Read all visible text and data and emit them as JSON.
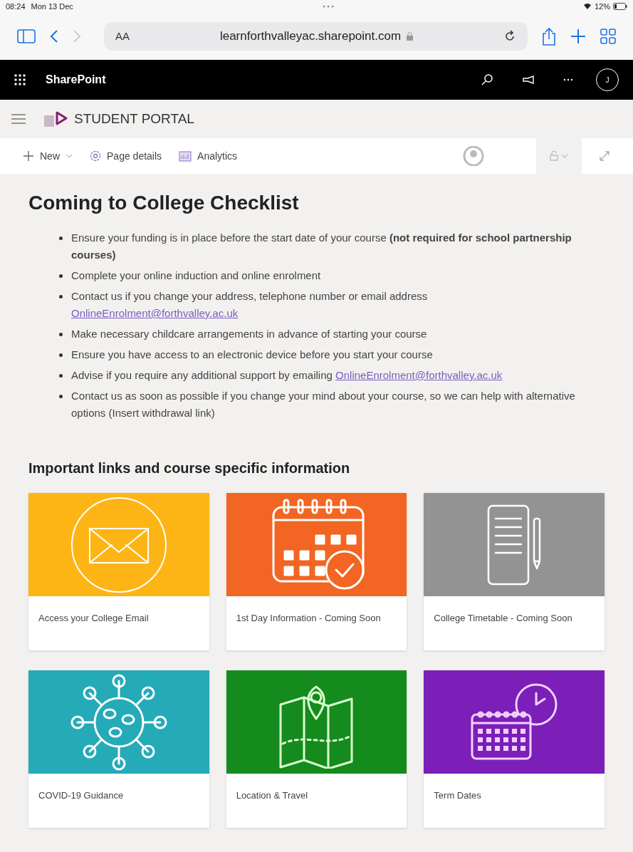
{
  "status_bar": {
    "time": "08:24",
    "date": "Mon 13 Dec",
    "battery": "12%"
  },
  "browser": {
    "text_size": "AA",
    "url": "learnforthvalleyac.sharepoint.com"
  },
  "suite_bar": {
    "app_name": "SharePoint",
    "avatar_initial": "J"
  },
  "site_header": {
    "title": "STUDENT PORTAL"
  },
  "command_bar": {
    "items": [
      {
        "kind": "new",
        "label": "New"
      },
      {
        "kind": "details",
        "label": "Page details"
      },
      {
        "kind": "analytics",
        "label": "Analytics"
      }
    ]
  },
  "checklist": {
    "title": "Coming to College Checklist",
    "items": [
      {
        "text": "Ensure your funding is in place before the start date of your course **(not required for school partnership courses)**"
      },
      {
        "text": "Complete your online induction and online enrolment"
      },
      {
        "text": "Contact us if you change your address, telephone number or email address",
        "link": "OnlineEnrolment@forthvalley.ac.uk"
      },
      {
        "text": "Make necessary childcare arrangements in advance of starting your course"
      },
      {
        "text": "Ensure you have access to an electronic device before you start your course"
      },
      {
        "text": "Advise if you require any additional support by emailing",
        "link": "OnlineEnrolment@forthvalley.ac.uk"
      },
      {
        "text": "Contact us as soon as possible if you change your mind about your course, so we can help with alternative options (Insert withdrawal link)"
      }
    ]
  },
  "links_section": {
    "title": "Important links and course specific information",
    "tiles": [
      {
        "label": "Access your College Email",
        "color": "#fdb515",
        "kind": "mail"
      },
      {
        "label": "1st Day Information - Coming Soon",
        "color": "#f26522",
        "kind": "calendar"
      },
      {
        "label": "College Timetable - Coming Soon",
        "color": "#939393",
        "kind": "notepad"
      },
      {
        "label": "COVID-19 Guidance",
        "color": "#25aab8",
        "kind": "virus"
      },
      {
        "label": "Location & Travel",
        "color": "#158a1d",
        "kind": "map"
      },
      {
        "label": "Term Dates",
        "color": "#7b1fb8",
        "kind": "clock"
      }
    ]
  }
}
